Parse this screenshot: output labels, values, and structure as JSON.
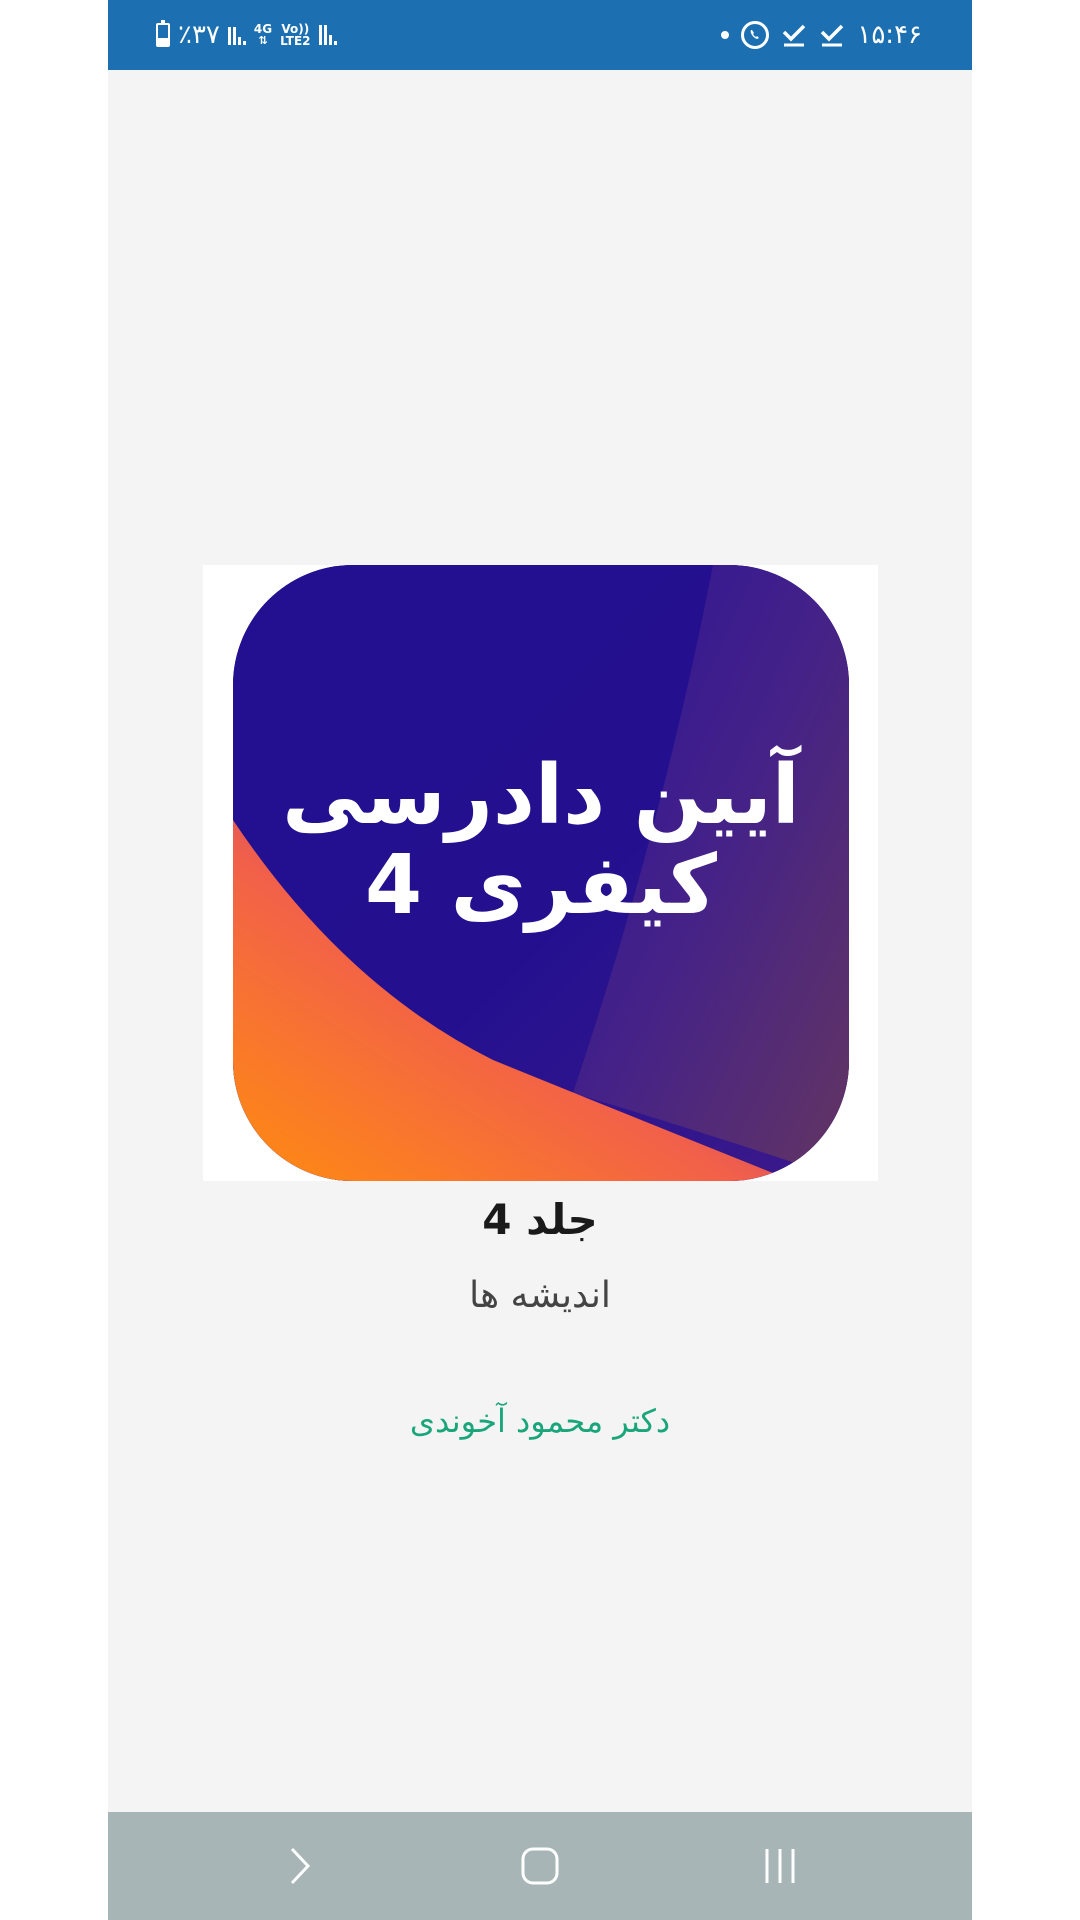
{
  "status_bar": {
    "battery": "٪۳۷",
    "battery_level": 0.37,
    "network_top": "4G",
    "network_bottom": "LTE2",
    "volte": "Vo))",
    "time": "۱۵:۴۶",
    "icons": [
      "battery-icon",
      "signal-icon",
      "whatsapp-icon",
      "check-icon",
      "check-icon",
      "dot-icon"
    ],
    "color": "#1c70b2"
  },
  "cover": {
    "title_line1": "آیین دادرسی",
    "title_line2": "کیفری 4"
  },
  "book": {
    "volume": "جلد 4",
    "category": "اندیشه ها",
    "author": "دکتر محمود آخوندی",
    "author_color": "#1aa67a"
  },
  "nav_bar": {
    "buttons": [
      "back-button",
      "home-button",
      "recents-button"
    ],
    "color": "#a7b5b6"
  }
}
